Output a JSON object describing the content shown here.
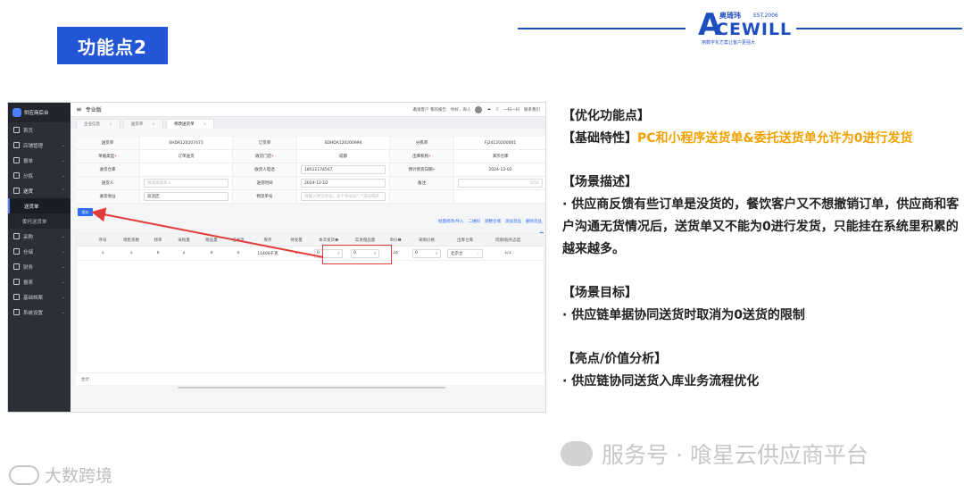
{
  "slide": {
    "title": "功能点2",
    "logo": {
      "mark": "A",
      "word": "CEWILL",
      "cn": "奥琦玮",
      "est": "EST.2006",
      "slogan": "用数字化方案让客户更强大"
    }
  },
  "app": {
    "brand": "供应商后台",
    "edition": "专业版",
    "topbar_right": [
      "邀请客户 我的报告",
      "你好，商人",
      "一扫一扫",
      "联系我们"
    ],
    "sidebar": [
      {
        "label": "首页",
        "chev": ""
      },
      {
        "label": "店铺管理",
        "chev": "⌄"
      },
      {
        "label": "报单",
        "chev": "⌄"
      },
      {
        "label": "分拣",
        "chev": "⌄"
      },
      {
        "label": "送货",
        "chev": "⌃"
      },
      {
        "label": "采购",
        "chev": "⌄"
      },
      {
        "label": "仓储",
        "chev": "⌄"
      },
      {
        "label": "财务",
        "chev": "⌄"
      },
      {
        "label": "报表",
        "chev": "⌄"
      },
      {
        "label": "基础档案",
        "chev": "⌄"
      },
      {
        "label": "系统设置",
        "chev": "⌄"
      }
    ],
    "sidebar_sub": [
      "送货单",
      "委托送货单"
    ],
    "tabs": [
      "企业信息",
      "送货单",
      "修改送货单"
    ],
    "form": [
      [
        {
          "label": "送货单",
          "value": "SHDA120207473",
          "req": false
        },
        {
          "label": "订货单",
          "value": "SDHDA120200994",
          "req": false
        },
        {
          "label": "分拣单",
          "value": "FJ24120200001",
          "req": false
        }
      ],
      [
        {
          "label": "单据类型",
          "value": "订单送货",
          "req": true
        },
        {
          "label": "收货门店",
          "value": "成都",
          "req": true
        },
        {
          "label": "出库机构",
          "value": "演示仓库",
          "req": true
        }
      ],
      [
        {
          "label": "收货仓库",
          "value": "",
          "req": false
        },
        {
          "label": "收货人电话",
          "value": "18511174567",
          "req": false,
          "input": true
        },
        {
          "label": "预计到货日期",
          "value": "2024-12-02",
          "req": true
        }
      ],
      [
        {
          "label": "送货人",
          "value": "请选择送货人",
          "req": false,
          "input": true,
          "ph": true
        },
        {
          "label": "送货时间",
          "value": "2024-12-10",
          "req": false,
          "input": true
        },
        {
          "label": "备注",
          "value": "",
          "req": false,
          "input": true,
          "count": "0/50"
        }
      ],
      [
        {
          "label": "收货地址",
          "value": "双流区",
          "req": false,
          "input": true
        },
        {
          "label": "物流单号",
          "value": "请输入物流单号，多个单号间\",\"\"或号隔开",
          "req": false,
          "input": true,
          "ph": true
        },
        {
          "label": "",
          "value": "",
          "req": false
        }
      ]
    ],
    "save_label": "保存",
    "toolbar": [
      "批量修改/导入",
      "二维码",
      "调整仓储",
      "添加货品",
      "删除货品"
    ],
    "grid": {
      "headers": [
        "",
        "序号",
        "销售系数",
        "频率",
        "采购量",
        "赠品量",
        "已发货",
        "库存",
        "待发量",
        "本次发货❶",
        "实发赠品量",
        "单价❶",
        "采购价格",
        "出库仓库",
        "货期/服务态度"
      ],
      "row": [
        "",
        "1",
        "1",
        "0",
        "2",
        "0",
        "0",
        "11400千克",
        "0",
        "0",
        "0",
        "24",
        "0",
        "北京仓",
        "1/1"
      ],
      "footer": "合计"
    }
  },
  "notes": {
    "h1": "【优化功能点】",
    "basic_prefix": "【基础特性】",
    "basic_text": "PC和小程序送货单&委托送货单允许为0进行发货",
    "h2": "【场景描述】",
    "desc": "·  供应商反馈有些订单是没货的，餐饮客户又不想撤销订单，供应商和客户沟通无货情况后，送货单又不能为0进行发货，只能挂在系统里积累的越来越多。",
    "h3": "【场景目标】",
    "goal": "·  供应链单据协同送货时取消为0送货的限制",
    "h4": "【亮点/价值分析】",
    "value": "·  供应链协同送货入库业务流程优化"
  },
  "watermarks": {
    "wechat": "服务号 · 喰星云供应商平台",
    "brand": "大数跨境"
  },
  "colors": {
    "accent": "#2356d6",
    "orange": "#f2a100",
    "highlight": "#e23b3b"
  }
}
